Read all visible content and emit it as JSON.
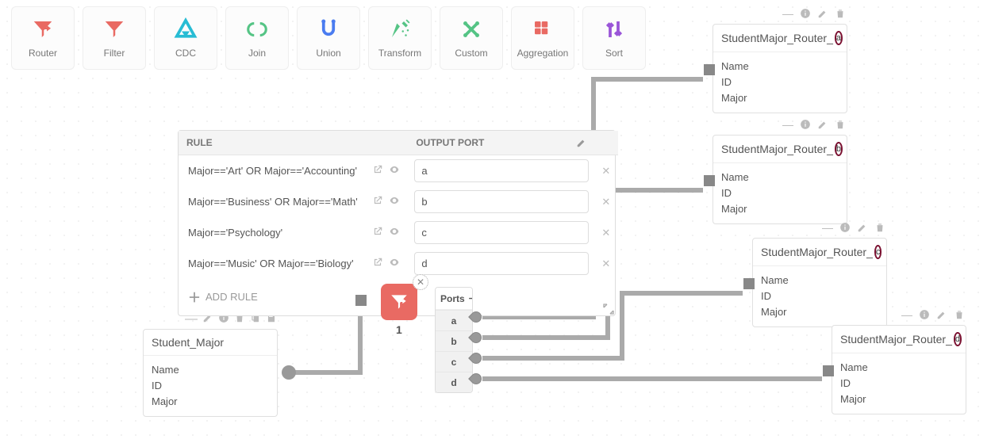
{
  "toolbar": [
    {
      "id": "router",
      "label": "Router",
      "color": "#e96a63"
    },
    {
      "id": "filter",
      "label": "Filter",
      "color": "#e96a63"
    },
    {
      "id": "cdc",
      "label": "CDC",
      "color": "#27bcd4"
    },
    {
      "id": "join",
      "label": "Join",
      "color": "#55c485"
    },
    {
      "id": "union",
      "label": "Union",
      "color": "#4a7cf0"
    },
    {
      "id": "transform",
      "label": "Transform",
      "color": "#55c485"
    },
    {
      "id": "custom",
      "label": "Custom",
      "color": "#55c485"
    },
    {
      "id": "aggregation",
      "label": "Aggregation",
      "color": "#e96a63"
    },
    {
      "id": "sort",
      "label": "Sort",
      "color": "#9a55d8"
    }
  ],
  "source": {
    "title": "Student_Major",
    "fields": [
      "Name",
      "ID",
      "Major"
    ]
  },
  "targets": [
    {
      "title": "StudentMajor_Router_",
      "suffix": "a",
      "fields": [
        "Name",
        "ID",
        "Major"
      ]
    },
    {
      "title": "StudentMajor_Router_",
      "suffix": "b",
      "fields": [
        "Name",
        "ID",
        "Major"
      ]
    },
    {
      "title": "StudentMajor_Router_",
      "suffix": "c",
      "fields": [
        "Name",
        "ID",
        "Major"
      ]
    },
    {
      "title": "StudentMajor_Router_",
      "suffix": "d",
      "fields": [
        "Name",
        "ID",
        "Major"
      ]
    }
  ],
  "router": {
    "label": "1",
    "ports_label": "Ports",
    "ports": [
      "a",
      "b",
      "c",
      "d"
    ]
  },
  "panel": {
    "headers": {
      "rule": "RULE",
      "output": "OUTPUT PORT"
    },
    "rows": [
      {
        "rule": "Major=='Art' OR Major=='Accounting'",
        "out": "a"
      },
      {
        "rule": "Major=='Business' OR Major=='Math'",
        "out": "b"
      },
      {
        "rule": "Major=='Psychology'",
        "out": "c"
      },
      {
        "rule": "Major=='Music' OR Major=='Biology'",
        "out": "d"
      }
    ],
    "add_label": "ADD RULE"
  }
}
